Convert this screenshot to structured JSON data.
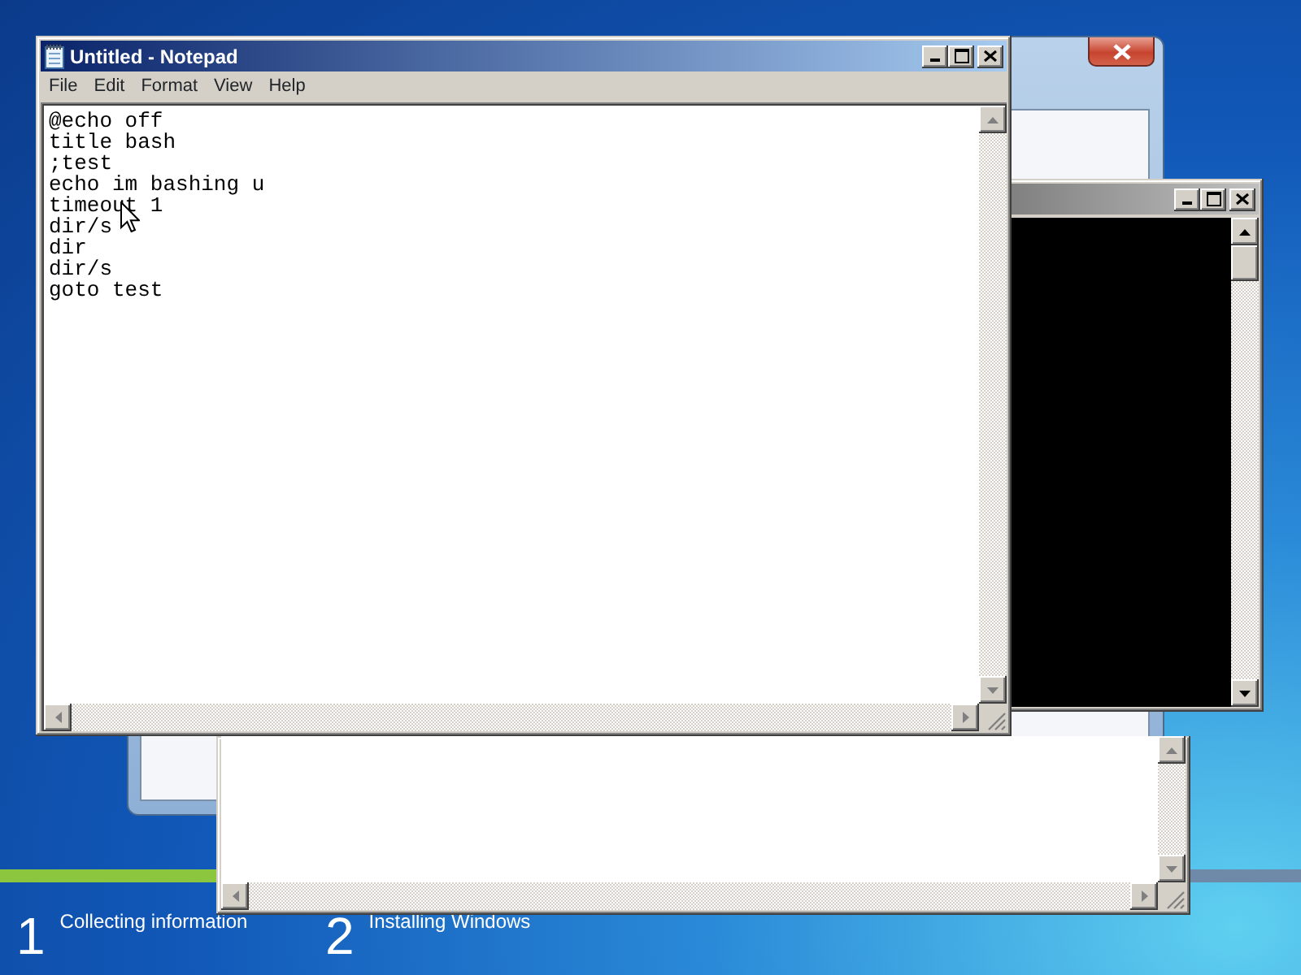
{
  "setup_window": {
    "controls": [
      {
        "kind": "close"
      }
    ]
  },
  "installer": {
    "steps": [
      {
        "number": "1",
        "label": "Collecting information"
      },
      {
        "number": "2",
        "label": "Installing Windows"
      }
    ]
  },
  "console_window": {
    "active": false,
    "controls": [
      {
        "kind": "minimize"
      },
      {
        "kind": "maximize"
      },
      {
        "kind": "close"
      }
    ]
  },
  "notepad": {
    "title": "Untitled - Notepad",
    "active": true,
    "controls": [
      {
        "kind": "minimize"
      },
      {
        "kind": "maximize"
      },
      {
        "kind": "close"
      }
    ],
    "menu": [
      "File",
      "Edit",
      "Format",
      "View",
      "Help"
    ],
    "lines": [
      "@echo off",
      "title bash",
      ";test",
      "echo im bashing u",
      "timeout 1",
      "dir/s",
      "dir",
      "dir/s",
      "goto test"
    ]
  }
}
